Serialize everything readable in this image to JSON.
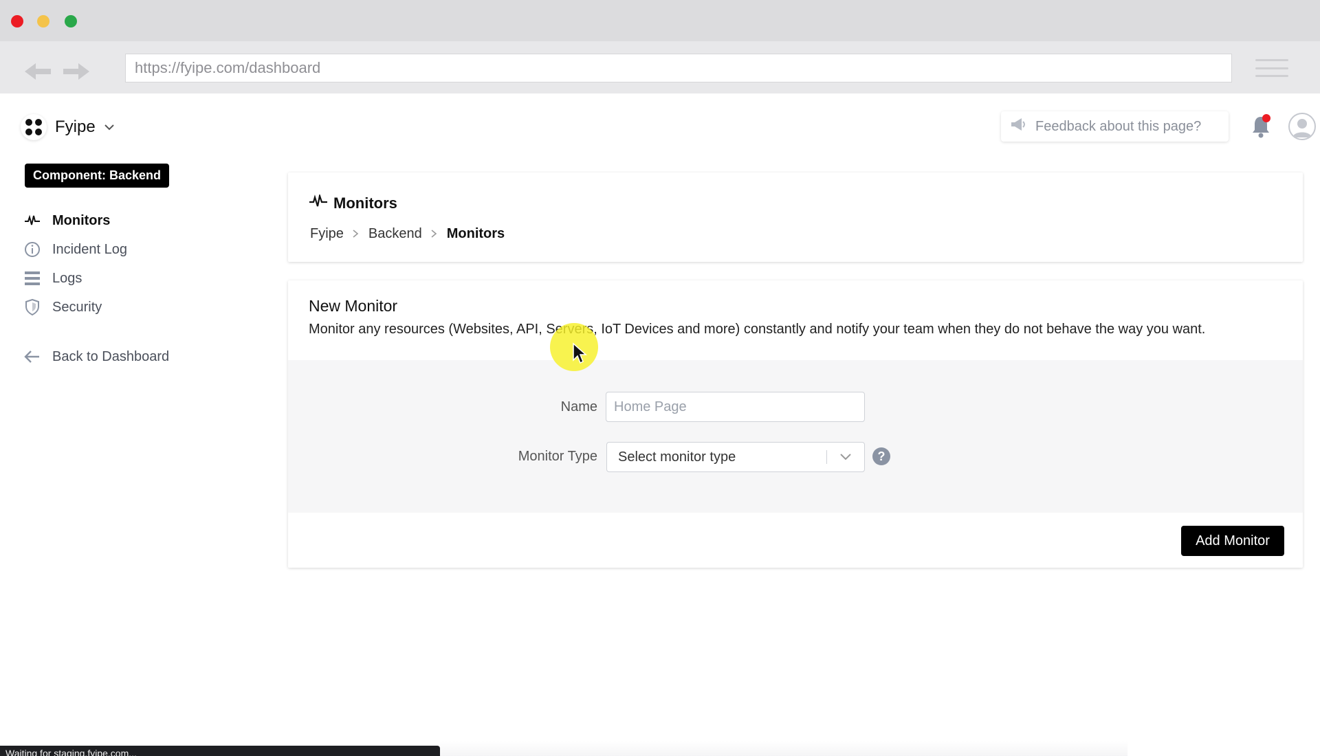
{
  "browser": {
    "url": "https://fyipe.com/dashboard"
  },
  "project": {
    "name": "Fyipe"
  },
  "header": {
    "feedback_placeholder": "Feedback about this page?"
  },
  "sidebar": {
    "component_badge": "Component: Backend",
    "items": [
      {
        "label": "Monitors",
        "icon": "activity-icon",
        "active": true
      },
      {
        "label": "Incident Log",
        "icon": "info-icon",
        "active": false
      },
      {
        "label": "Logs",
        "icon": "list-icon",
        "active": false
      },
      {
        "label": "Security",
        "icon": "shield-icon",
        "active": false
      }
    ],
    "back_label": "Back to Dashboard"
  },
  "page": {
    "title": "Monitors",
    "breadcrumb": [
      "Fyipe",
      "Backend",
      "Monitors"
    ]
  },
  "form": {
    "title": "New Monitor",
    "description": "Monitor any resources (Websites, API, Servers, IoT Devices and more) constantly and notify your team when they do not behave the way you want.",
    "name_label": "Name",
    "name_placeholder": "Home Page",
    "type_label": "Monitor Type",
    "type_value": "Select monitor type",
    "help_glyph": "?",
    "submit_label": "Add Monitor"
  },
  "status_bar": {
    "text": "Waiting for staging.fyipe.com..."
  },
  "colors": {
    "accent": "#000000",
    "notification_dot": "#ec1c24",
    "form_body_bg": "#f6f6f7"
  }
}
